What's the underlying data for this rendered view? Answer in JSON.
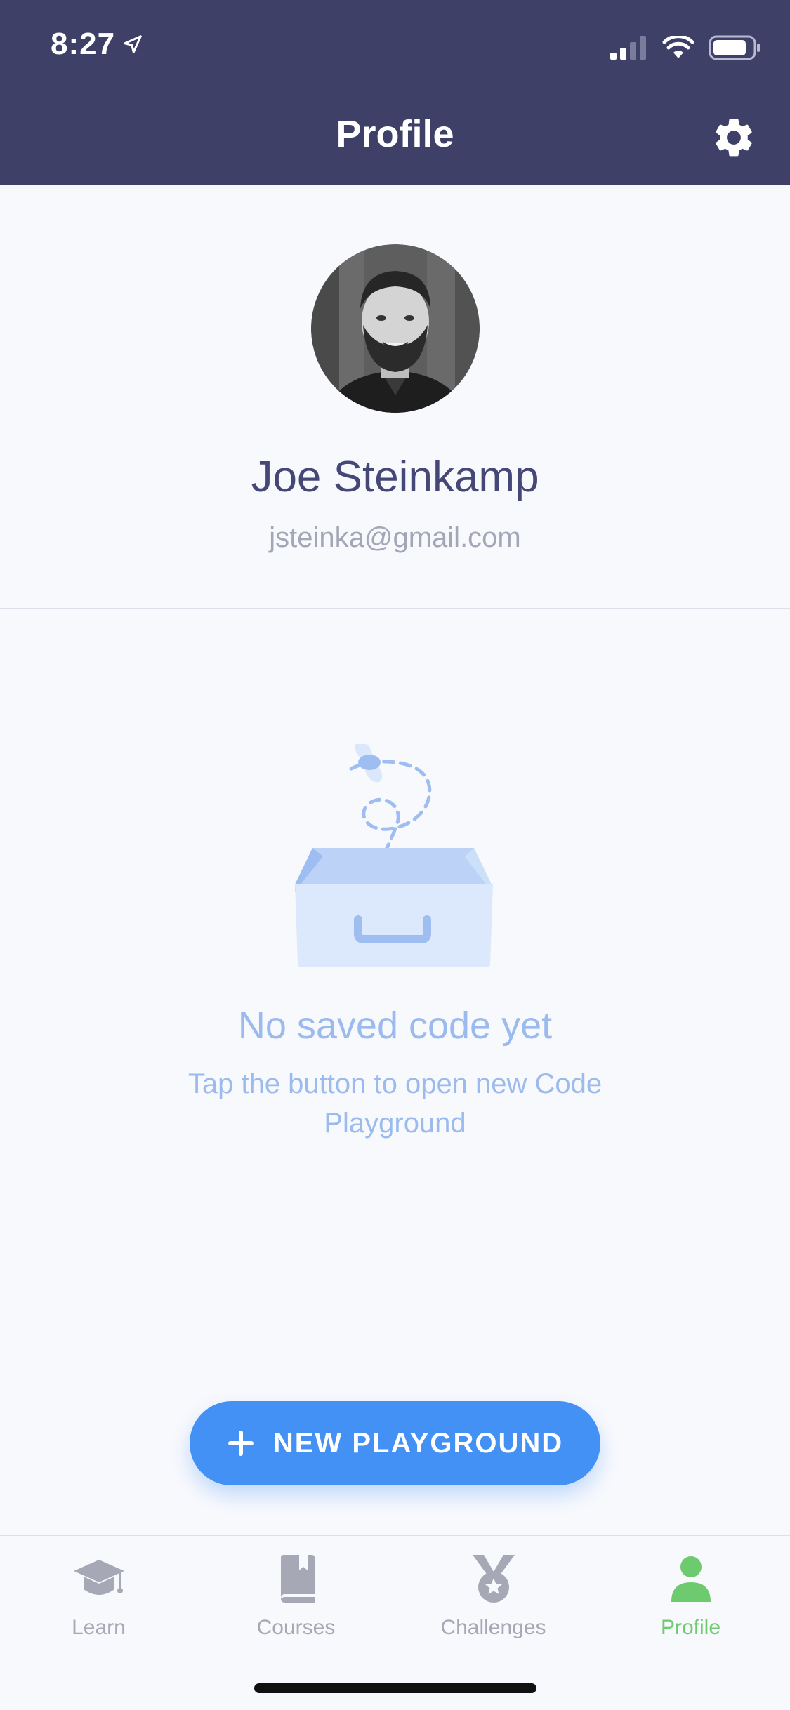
{
  "status_bar": {
    "time": "8:27",
    "icons": [
      "location-arrow-icon",
      "cellular-signal-icon",
      "wifi-icon",
      "battery-icon"
    ]
  },
  "header": {
    "title": "Profile",
    "settings_icon": "gear-icon"
  },
  "profile": {
    "name": "Joe Steinkamp",
    "email": "jsteinka@gmail.com"
  },
  "empty_state": {
    "title": "No saved code yet",
    "subtitle": "Tap the button to open new Code Playground",
    "illustration": "empty-box-icon"
  },
  "actions": {
    "new_playground_label": "NEW PLAYGROUND",
    "new_playground_icon": "plus-icon"
  },
  "tabs": [
    {
      "label": "Learn",
      "icon": "graduation-cap-icon",
      "active": false
    },
    {
      "label": "Courses",
      "icon": "book-icon",
      "active": false
    },
    {
      "label": "Challenges",
      "icon": "medal-icon",
      "active": false
    },
    {
      "label": "Profile",
      "icon": "person-icon",
      "active": true
    }
  ],
  "colors": {
    "header_bg": "#3e4067",
    "accent_blue": "#4391f5",
    "active_tab": "#6dca6e",
    "inactive_tab": "#a6a8b5",
    "empty_state_text": "#9bbbee",
    "name_text": "#454876"
  }
}
